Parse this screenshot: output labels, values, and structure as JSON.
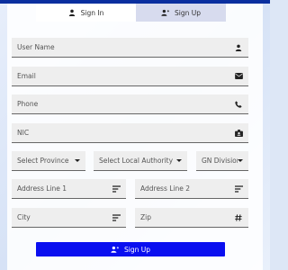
{
  "tabs": {
    "signin": "Sign In",
    "signup": "Sign Up"
  },
  "fields": {
    "user_name": "User Name",
    "email": "Email",
    "phone": "Phone",
    "nic": "NIC",
    "province": "Select Province",
    "local_authority": "Select Local Authority",
    "gn_division": "GN Division",
    "address1": "Address Line 1",
    "address2": "Address Line 2",
    "city": "City",
    "zip": "Zip"
  },
  "button": {
    "label": "Sign Up"
  },
  "colors": {
    "primary_button": "#0a0ff0",
    "active_tab": "#d7dbee",
    "field_bg": "#eeeeee"
  },
  "icons": {
    "user_name": "user-icon",
    "email": "envelope-icon",
    "phone": "phone-icon",
    "nic": "id-badge-icon",
    "address": "align-lines-icon",
    "zip": "hash-icon",
    "signup": "user-plus-icon"
  }
}
